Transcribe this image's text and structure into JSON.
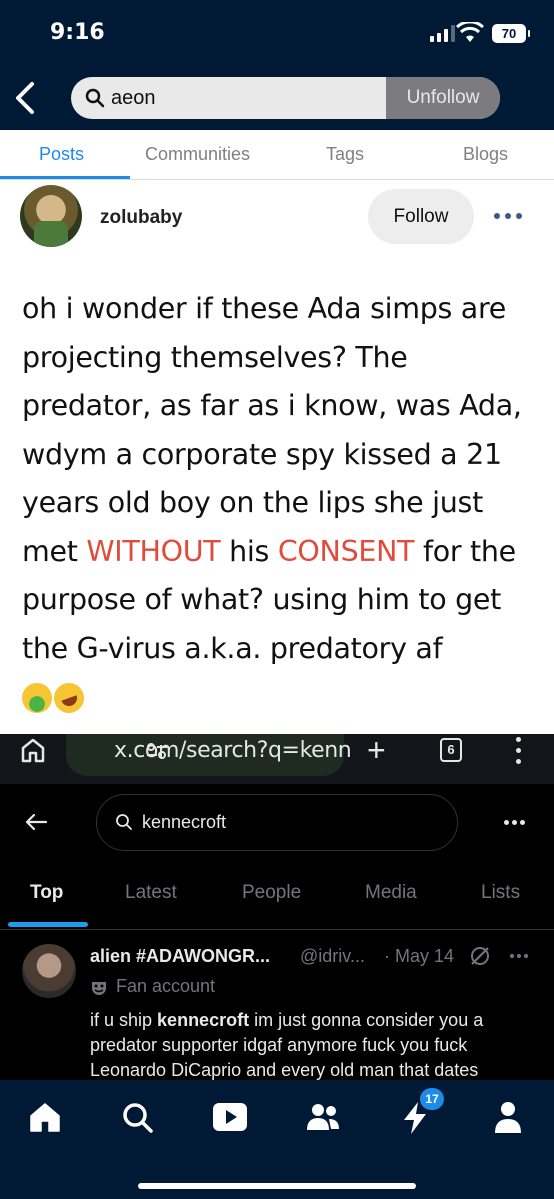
{
  "status_bar": {
    "time": "9:16",
    "battery": "70"
  },
  "header": {
    "search_query": "aeon",
    "unfollow_label": "Unfollow"
  },
  "tabs": [
    {
      "label": "Posts",
      "active": true
    },
    {
      "label": "Communities",
      "active": false
    },
    {
      "label": "Tags",
      "active": false
    },
    {
      "label": "Blogs",
      "active": false
    }
  ],
  "post": {
    "username": "zolubaby",
    "follow_label": "Follow",
    "text_1": "oh i wonder if these Ada simps are projecting themselves? The predator, as far as i know, was Ada, wdym a corporate spy kissed a 21 years old boy on the lips she just met ",
    "highlight_1": "WITHOUT",
    "text_2": " his ",
    "highlight_2": "CONSENT",
    "text_3": " for the purpose of what? using him to get the G-virus a.k.a. predatory af",
    "emojis": [
      "nauseated-face",
      "rolling-on-floor-laughing"
    ],
    "highlight_color": "#e24b3b"
  },
  "embedded_screenshot": {
    "browser": {
      "url": "x.com/search?q=kenn",
      "tab_count": "6"
    },
    "search_query": "kennecroft",
    "tabs": [
      "Top",
      "Latest",
      "People",
      "Media",
      "Lists"
    ],
    "active_tab": "Top",
    "tweet": {
      "display_name": "alien #ADAWONGR...",
      "handle": "@idriv...",
      "date": "· May 14",
      "label": "Fan account",
      "text_before": "if u ship ",
      "text_bold": "kennecroft",
      "text_after": " im just gonna consider you a predator supporter idgaf anymore fuck you fuck Leonardo DiCaprio and every old man that dates"
    }
  },
  "bottom_nav": {
    "items": [
      "home-icon",
      "search-icon",
      "play-icon",
      "people-icon",
      "activity-icon",
      "account-icon"
    ],
    "activity_badge": "17"
  },
  "colors": {
    "brand_navy": "#001935",
    "accent_blue": "#1f8be8",
    "x_blue": "#1d9bf0"
  }
}
